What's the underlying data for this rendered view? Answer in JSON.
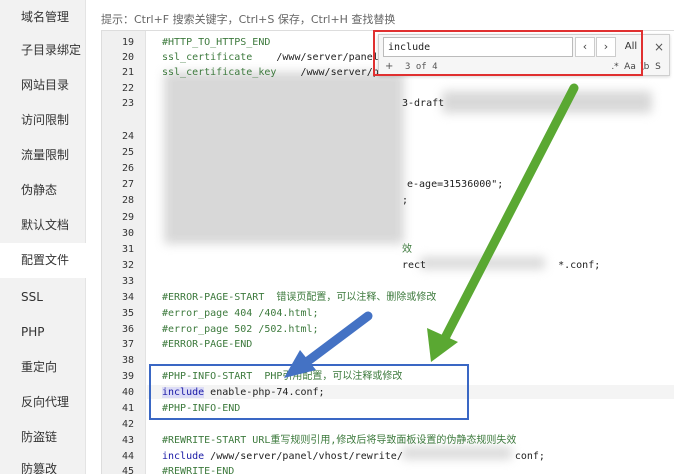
{
  "sidebar": {
    "items": [
      {
        "label": "域名管理"
      },
      {
        "label": "子目录绑定"
      },
      {
        "label": "网站目录"
      },
      {
        "label": "访问限制"
      },
      {
        "label": "流量限制"
      },
      {
        "label": "伪静态"
      },
      {
        "label": "默认文档"
      },
      {
        "label": "配置文件"
      },
      {
        "label": "SSL"
      },
      {
        "label": "PHP"
      },
      {
        "label": "重定向"
      },
      {
        "label": "反向代理"
      },
      {
        "label": "防盗链"
      },
      {
        "label": "防篡改"
      }
    ],
    "active_index": 7
  },
  "hint": "提示：Ctrl+F 搜索关键字，Ctrl+S 保存，Ctrl+H 查找替换",
  "editor": {
    "line_numbers": [
      "19",
      "20",
      "21",
      "22",
      "23",
      "24",
      "25",
      "26",
      "27",
      "28",
      "29",
      "30",
      "31",
      "32",
      "33",
      "34",
      "35",
      "36",
      "37",
      "38",
      "39",
      "40",
      "41",
      "42",
      "43",
      "44",
      "45"
    ],
    "lines": {
      "l19": "#HTTP_TO_HTTPS_END",
      "l20a": "ssl_certificate",
      "l20b": "    /www/server/panel/",
      "l21a": "ssl_certificate_key",
      "l21b": "    /www/server/pa",
      "l23": "3-draft",
      "l27": "e-age=31536000\";",
      "l28": ";",
      "l31": "效",
      "l32a": "rect",
      "l32b": "*.conf;",
      "l34": "#ERROR-PAGE-START  错误页配置，可以注释、删除或修改",
      "l35": "#error_page 404 /404.html;",
      "l36": "#error_page 502 /502.html;",
      "l37": "#ERROR-PAGE-END",
      "l39": "#PHP-INFO-START  PHP引用配置，可以注释或修改",
      "l40_kw": "include",
      "l40_rest": " enable-php-74.conf;",
      "l41": "#PHP-INFO-END",
      "l43": "#REWRITE-START URL重写规则引用,修改后将导致面板设置的伪静态规则失效",
      "l44_kw": "include",
      "l44_rest": " /www/server/panel/vhost/rewrite/",
      "l44_end": "conf;",
      "l45": "#REWRITE-END"
    }
  },
  "search": {
    "value": "include",
    "prev_icon": "chevron-left-icon",
    "next_icon": "chevron-right-icon",
    "prev_glyph": "‹",
    "next_glyph": "›",
    "all_label": "All",
    "close_glyph": "×",
    "plus_glyph": "+",
    "count": "3 of 4",
    "opt_regex": ".*",
    "opt_case": "Aa",
    "opt_word": "\\b",
    "opt_selection": "S"
  },
  "colors": {
    "annotation_red": "#e03030",
    "annotation_blue": "#3a67c4",
    "annotation_green": "#5aa832"
  }
}
